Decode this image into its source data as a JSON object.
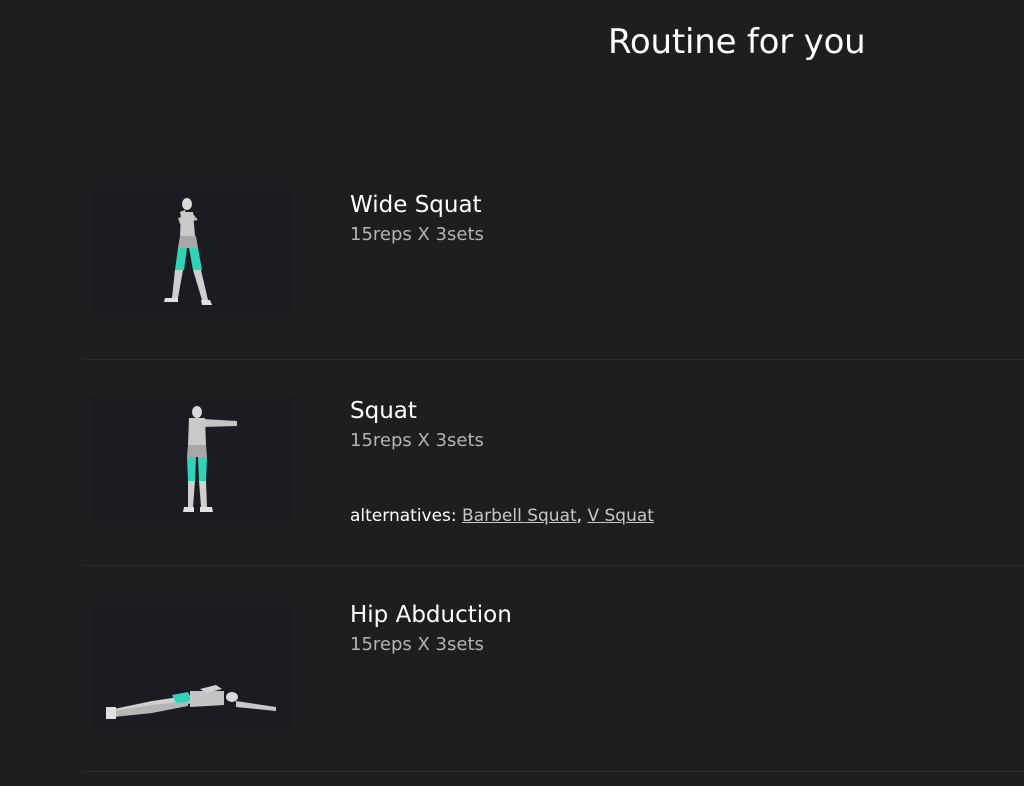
{
  "page": {
    "title": "Routine for you"
  },
  "exercises": [
    {
      "name": "Wide Squat",
      "reps": "15reps X 3sets",
      "illustration": "figure-wide-squat"
    },
    {
      "name": "Squat",
      "reps": "15reps X 3sets",
      "illustration": "figure-squat",
      "alternatives_label": "alternatives: ",
      "alternatives": [
        "Barbell Squat",
        "V Squat"
      ],
      "separator": ", "
    },
    {
      "name": "Hip Abduction",
      "reps": "15reps X 3sets",
      "illustration": "figure-hip-abduction"
    }
  ],
  "colors": {
    "background": "#1e1e21",
    "thumbnail_bg": "#1a1c21",
    "muscle_highlight": "#2fd3b8",
    "divider": "#2c2c30"
  }
}
